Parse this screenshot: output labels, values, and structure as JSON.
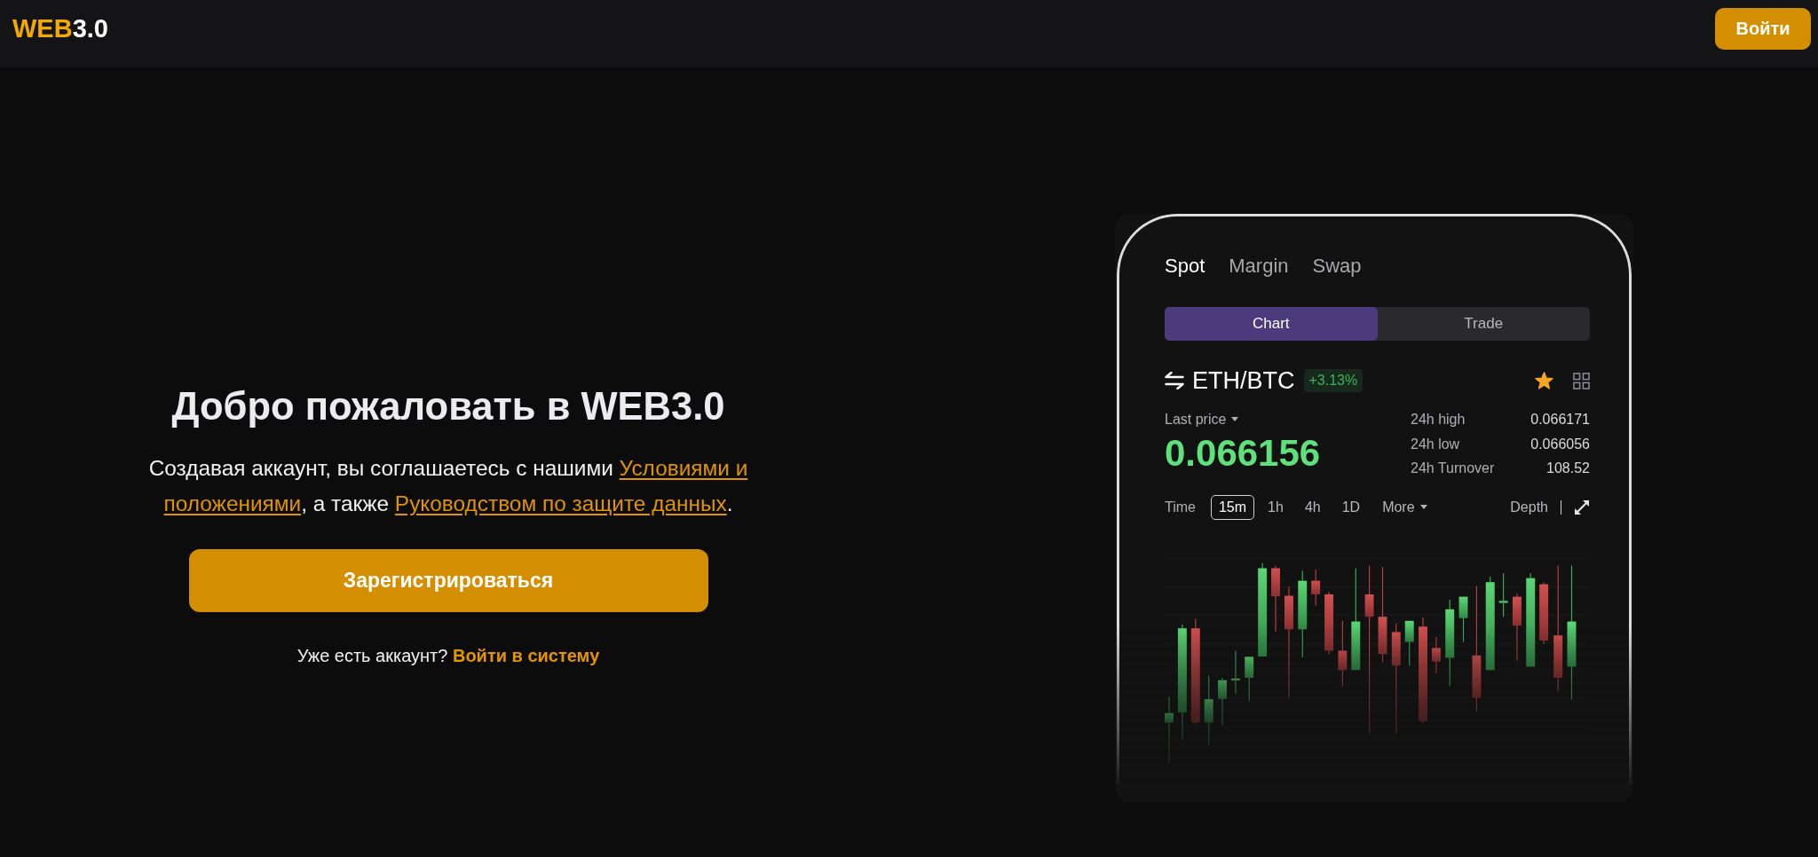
{
  "header": {
    "logo": {
      "accent": "WEB",
      "text": "3.0"
    },
    "login_button": "Войти"
  },
  "hero": {
    "title": "Добро пожаловать в WEB3.0",
    "consent": [
      {
        "kind": "text",
        "text": "Создавая аккаунт, вы соглашаетесь с нашими "
      },
      {
        "kind": "link",
        "text": "Условиями и"
      },
      {
        "kind": "link",
        "text": "положениями"
      },
      {
        "kind": "text",
        "text": ", а также "
      },
      {
        "kind": "link",
        "text": "Руководством по защите данных"
      },
      {
        "kind": "text",
        "text": "."
      }
    ],
    "register_button": "Зарегистрироваться",
    "signin_prompt": "Уже есть аккаунт?",
    "signin_link": "Войти в систему"
  },
  "phone": {
    "tabs": [
      {
        "label": "Spot",
        "selected": true
      },
      {
        "label": "Margin",
        "selected": false
      },
      {
        "label": "Swap",
        "selected": false
      }
    ],
    "view_toggle": [
      {
        "label": "Chart",
        "selected": true
      },
      {
        "label": "Trade",
        "selected": false
      }
    ],
    "pair": "ETH/BTC",
    "change": "+3.13%",
    "favorite": true,
    "last_price_label": "Last price",
    "last_price": "0.066156",
    "stats": [
      {
        "label": "24h high",
        "value": "0.066171"
      },
      {
        "label": "24h low",
        "value": "0.066056"
      },
      {
        "label": "24h Turnover",
        "value": "108.52"
      }
    ],
    "time_label": "Time",
    "intervals": [
      {
        "label": "15m",
        "selected": true
      },
      {
        "label": "1h",
        "selected": false
      },
      {
        "label": "4h",
        "selected": false
      },
      {
        "label": "1D",
        "selected": false
      }
    ],
    "more": "More",
    "depth": "Depth"
  }
}
